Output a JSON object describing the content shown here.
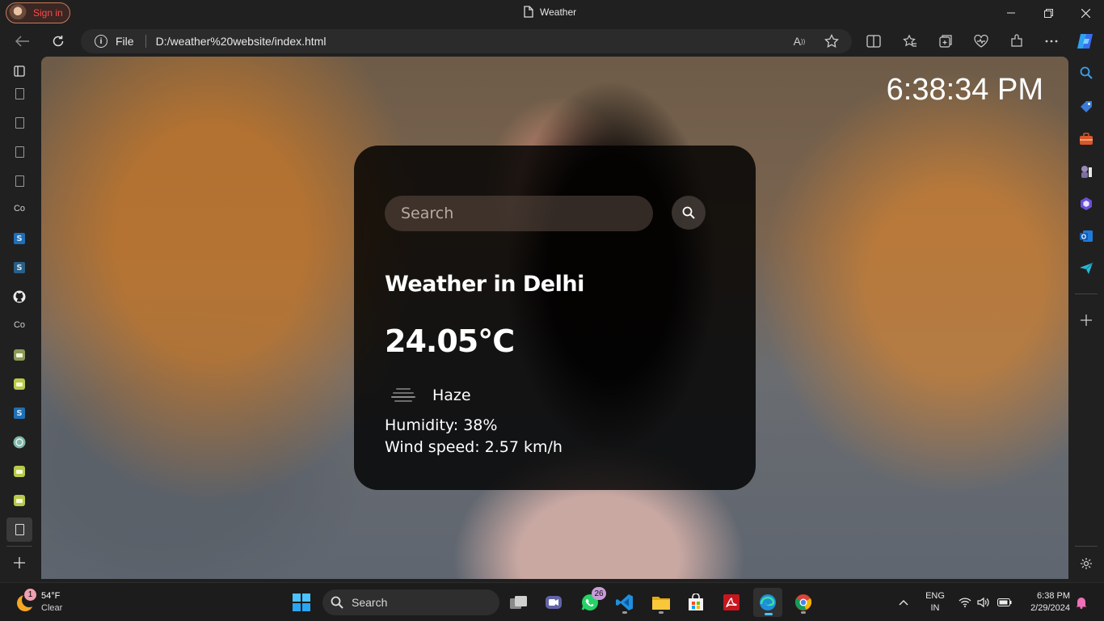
{
  "browser": {
    "signin_label": "Sign in",
    "window_title": "Weather",
    "address": {
      "scheme_label": "File",
      "url": "D:/weather%20website/index.html"
    },
    "left_sidebar": {
      "co_label_1": "Co",
      "co_label_2": "Co",
      "s_label": "S"
    }
  },
  "page": {
    "clock": "6:38:34 PM",
    "search": {
      "placeholder": "Search"
    },
    "weather": {
      "title": "Weather in Delhi",
      "temperature": "24.05°C",
      "condition": "Haze",
      "humidity": "Humidity: 38%",
      "wind": "Wind speed: 2.57 km/h"
    }
  },
  "taskbar": {
    "weather_widget": {
      "temp": "54°F",
      "desc": "Clear",
      "badge": "1"
    },
    "search_label": "Search",
    "whatsapp_badge": "26",
    "language": {
      "line1": "ENG",
      "line2": "IN"
    },
    "clock": {
      "time": "6:38 PM",
      "date": "2/29/2024"
    }
  }
}
